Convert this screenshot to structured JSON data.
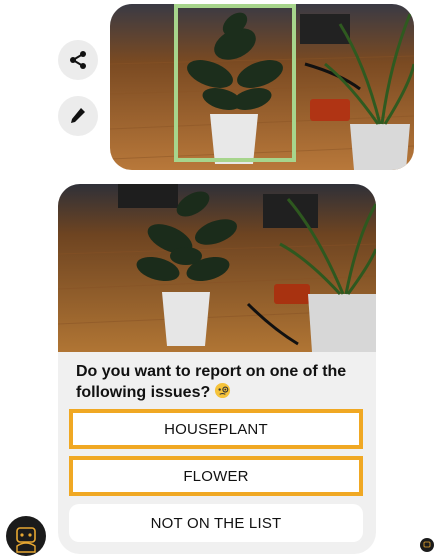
{
  "actions": {
    "share_icon": "share-icon",
    "edit_icon": "pencil-icon"
  },
  "card": {
    "question": "Do you want to report on one of the following issues?",
    "question_emoji": "face-with-monocle",
    "options": [
      {
        "label": "HOUSEPLANT",
        "highlighted": true
      },
      {
        "label": "FLOWER",
        "highlighted": true
      },
      {
        "label": "NOT ON THE LIST",
        "highlighted": false
      }
    ]
  },
  "colors": {
    "option_highlight": "#f0a823",
    "photo_selection": "#a7d58c",
    "bubble_background": "#f0f0f0"
  }
}
